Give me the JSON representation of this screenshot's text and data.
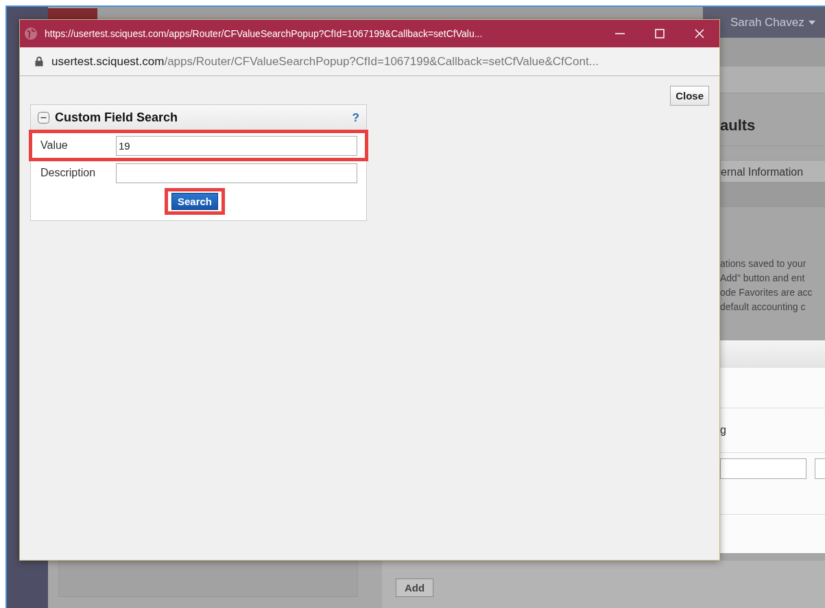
{
  "background": {
    "user_menu": "Sarah Chavez",
    "heading": "aults",
    "tab": "ernal Information",
    "notes": [
      "ations saved to your",
      "Add\" button and ent",
      "ode Favorites are acc",
      "default accounting c"
    ],
    "card_text": "g",
    "add_button": "Add"
  },
  "popup": {
    "title": "https://usertest.sciquest.com/apps/Router/CFValueSearchPopup?CfId=1067199&Callback=setCfValu...",
    "address": {
      "host": "usertest.sciquest.com",
      "path": "/apps/Router/CFValueSearchPopup?CfId=1067199&Callback=setCfValue&CfCont..."
    },
    "close_button": "Close",
    "panel": {
      "title": "Custom Field Search",
      "expanded": true,
      "help": "?",
      "fields": [
        {
          "label": "Value",
          "value": "19",
          "highlighted": true
        },
        {
          "label": "Description",
          "highlighted": false
        }
      ],
      "search_button": {
        "label": "Search",
        "highlighted": true
      }
    }
  }
}
